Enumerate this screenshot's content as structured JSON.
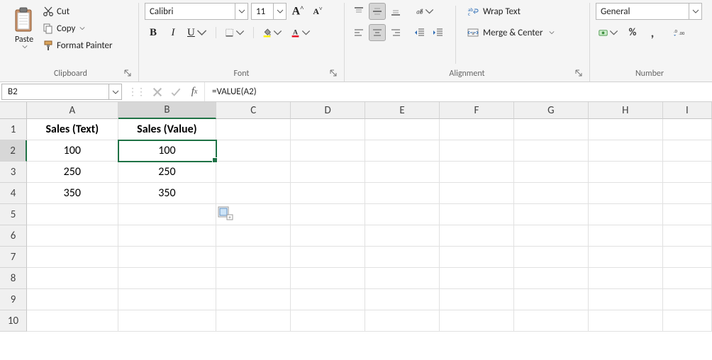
{
  "ribbon": {
    "clipboard": {
      "title": "Clipboard",
      "paste": "Paste",
      "cut": "Cut",
      "copy": "Copy",
      "format_painter": "Format Painter"
    },
    "font": {
      "title": "Font",
      "name": "Calibri",
      "size": "11"
    },
    "alignment": {
      "title": "Alignment",
      "wrap_text": "Wrap Text",
      "merge_center": "Merge & Center"
    },
    "number": {
      "title": "Number",
      "format": "General"
    }
  },
  "formula_bar": {
    "name_box": "B2",
    "formula": "=VALUE(A2)"
  },
  "grid": {
    "columns": [
      "A",
      "B",
      "C",
      "D",
      "E",
      "F",
      "G",
      "H",
      "I"
    ],
    "row_numbers": [
      "1",
      "2",
      "3",
      "4",
      "5",
      "6",
      "7",
      "8",
      "9",
      "10"
    ],
    "selected_col": "B",
    "selected_row": "2",
    "data": {
      "A1": "Sales (Text)",
      "B1": "Sales (Value)",
      "A2": "100",
      "B2": "100",
      "A3": "250",
      "B3": "250",
      "A4": "350",
      "B4": "350"
    }
  }
}
